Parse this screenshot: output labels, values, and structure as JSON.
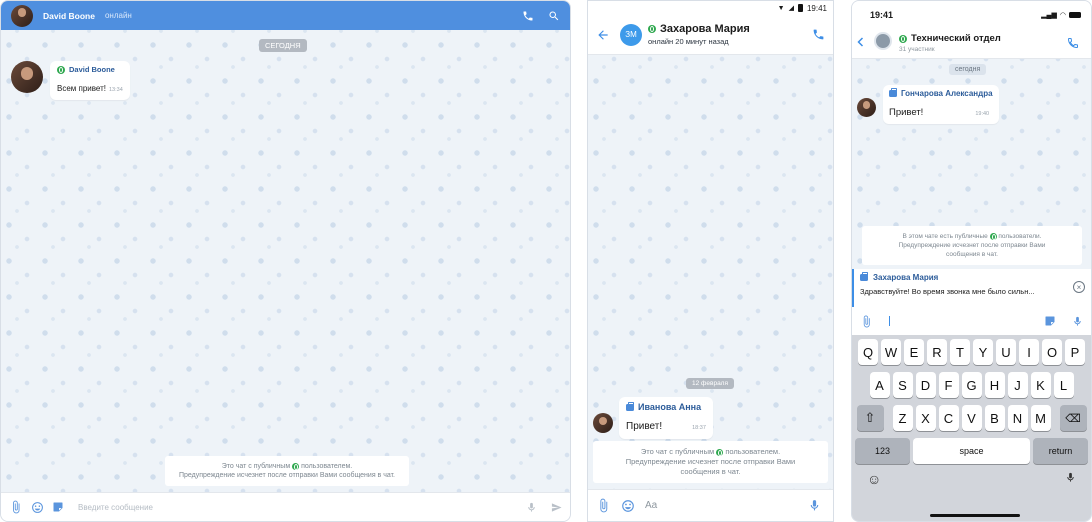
{
  "desktop": {
    "contact_name": "David Boone",
    "contact_status": "онлайн",
    "date_label": "СЕГОДНЯ",
    "message": {
      "sender": "David Boone",
      "text": "Всем привет!",
      "time": "13:34"
    },
    "notice_line1_before": "Это чат с публичным",
    "notice_line1_after": "пользователем.",
    "notice_line2": "Предупреждение исчезнет после отправки Вами сообщения в чат.",
    "input_placeholder": "Введите сообщение"
  },
  "android": {
    "status_time": "19:41",
    "contact_initials": "ЗМ",
    "contact_name": "Захарова Мария",
    "contact_status": "онлайн 20 минут назад",
    "date_label": "12 февраля",
    "message": {
      "sender": "Иванова Анна",
      "text": "Привет!",
      "time": "18:37"
    },
    "notice_line1_before": "Это чат с публичным",
    "notice_line1_after": "пользователем.",
    "notice_line2": "Предупреждение исчезнет после отправки Вами",
    "notice_line3": "сообщения в чат.",
    "input_placeholder": "Aa"
  },
  "ios": {
    "status_time": "19:41",
    "chat_title": "Технический отдел",
    "chat_subtitle": "31 участник",
    "date_label": "сегодня",
    "message": {
      "sender": "Гончарова Александра",
      "text": "Привет!",
      "time": "19:40"
    },
    "notice_line1_before": "В этом чате есть публичные",
    "notice_line1_after": "пользователи.",
    "notice_line2": "Предупреждение исчезнет после отправки Вами",
    "notice_line3": "сообщения в чат.",
    "reply": {
      "sender": "Захарова Мария",
      "text": "Здравствуйте! Во время звонка мне было сильн..."
    },
    "keyboard": {
      "row1": [
        "Q",
        "W",
        "E",
        "R",
        "T",
        "Y",
        "U",
        "I",
        "O",
        "P"
      ],
      "row2": [
        "A",
        "S",
        "D",
        "F",
        "G",
        "H",
        "J",
        "K",
        "L"
      ],
      "row3": [
        "Z",
        "X",
        "C",
        "V",
        "B",
        "N",
        "M"
      ],
      "numbers_label": "123",
      "space_label": "space",
      "return_label": "return"
    }
  },
  "colors": {
    "accent": "#4f8fdf",
    "online": "#2fa84f",
    "name_blue": "#2c5c9a"
  }
}
